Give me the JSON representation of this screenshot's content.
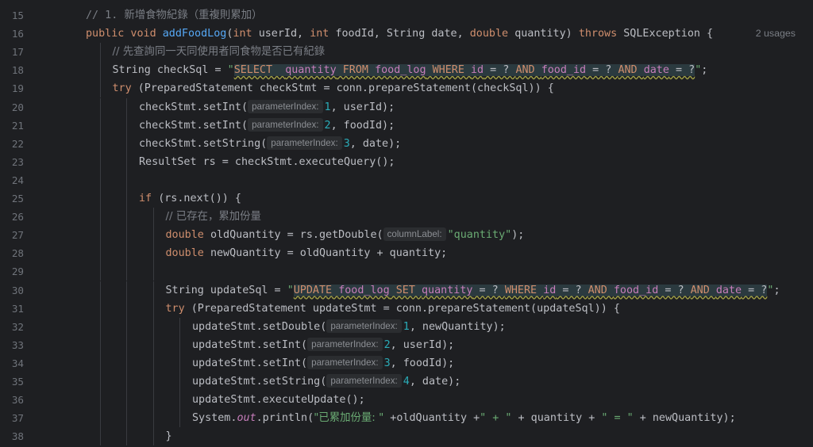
{
  "editor": {
    "usages": "2 usages",
    "lines": [
      {
        "n": "15",
        "indent": 1,
        "tokens": [
          [
            "cmt",
            "// 1. "
          ],
          [
            "cmt",
            "新增食物紀錄（重複則累加）"
          ]
        ]
      },
      {
        "n": "16",
        "indent": 1,
        "tokens": [
          [
            "kw",
            "public void "
          ],
          [
            "fn",
            "addFoodLog"
          ],
          [
            "plain",
            "("
          ],
          [
            "kw",
            "int "
          ],
          [
            "plain",
            "userId, "
          ],
          [
            "kw",
            "int "
          ],
          [
            "plain",
            "foodId, String date, "
          ],
          [
            "kw",
            "double "
          ],
          [
            "plain",
            "quantity) "
          ],
          [
            "kw",
            "throws "
          ],
          [
            "plain",
            "SQLException {"
          ]
        ]
      },
      {
        "n": "17",
        "indent": 2,
        "tokens": [
          [
            "cmt",
            "// 先查詢同一天同使用者同食物是否已有紀錄"
          ]
        ]
      },
      {
        "n": "18",
        "indent": 2,
        "tokens": [
          [
            "plain",
            "String checkSql = "
          ],
          [
            "str",
            "\""
          ],
          [
            "sql-kw",
            "SELECT  "
          ],
          [
            "sql-id",
            "quantity"
          ],
          [
            "sql-kw",
            " FROM "
          ],
          [
            "sql-id",
            "food_log"
          ],
          [
            "sql-kw",
            " WHERE "
          ],
          [
            "sql-id",
            "id"
          ],
          [
            "sql-ph",
            " = ? "
          ],
          [
            "sql-kw",
            "AND "
          ],
          [
            "sql-id",
            "food_id"
          ],
          [
            "sql-ph",
            " = ? "
          ],
          [
            "sql-kw",
            "AND "
          ],
          [
            "sql-id",
            "date"
          ],
          [
            "sql-ph",
            " = ?"
          ],
          [
            "str",
            "\""
          ],
          [
            "plain",
            ";"
          ]
        ]
      },
      {
        "n": "19",
        "indent": 2,
        "tokens": [
          [
            "kw",
            "try "
          ],
          [
            "plain",
            "(PreparedStatement checkStmt = "
          ],
          [
            "plain",
            "conn"
          ],
          [
            "plain",
            ".prepareStatement(checkSql)) {"
          ]
        ]
      },
      {
        "n": "20",
        "indent": 3,
        "tokens": [
          [
            "plain",
            "checkStmt.setInt("
          ],
          [
            "hint",
            "parameterIndex:"
          ],
          [
            "num",
            "1"
          ],
          [
            "plain",
            ", userId);"
          ]
        ]
      },
      {
        "n": "21",
        "indent": 3,
        "tokens": [
          [
            "plain",
            "checkStmt.setInt("
          ],
          [
            "hint",
            "parameterIndex:"
          ],
          [
            "num",
            "2"
          ],
          [
            "plain",
            ", foodId);"
          ]
        ]
      },
      {
        "n": "22",
        "indent": 3,
        "tokens": [
          [
            "plain",
            "checkStmt.setString("
          ],
          [
            "hint",
            "parameterIndex:"
          ],
          [
            "num",
            "3"
          ],
          [
            "plain",
            ", date);"
          ]
        ]
      },
      {
        "n": "23",
        "indent": 3,
        "tokens": [
          [
            "plain",
            "ResultSet rs = checkStmt.executeQuery();"
          ]
        ]
      },
      {
        "n": "24",
        "indent": 3,
        "tokens": []
      },
      {
        "n": "25",
        "indent": 3,
        "tokens": [
          [
            "kw",
            "if "
          ],
          [
            "plain",
            "(rs.next()) {"
          ]
        ]
      },
      {
        "n": "26",
        "indent": 4,
        "tokens": [
          [
            "cmt",
            "// 已存在，累加份量"
          ]
        ]
      },
      {
        "n": "27",
        "indent": 4,
        "tokens": [
          [
            "kw",
            "double "
          ],
          [
            "plain",
            "oldQuantity = rs.getDouble("
          ],
          [
            "hint",
            "columnLabel:"
          ],
          [
            "str",
            "\"quantity\""
          ],
          [
            "plain",
            ");"
          ]
        ]
      },
      {
        "n": "28",
        "indent": 4,
        "tokens": [
          [
            "kw",
            "double "
          ],
          [
            "plain",
            "newQuantity = oldQuantity + quantity;"
          ]
        ]
      },
      {
        "n": "29",
        "indent": 4,
        "tokens": []
      },
      {
        "n": "30",
        "indent": 4,
        "tokens": [
          [
            "plain",
            "String updateSql = "
          ],
          [
            "str",
            "\""
          ],
          [
            "sql-kw",
            "UPDATE "
          ],
          [
            "sql-id",
            "food_log"
          ],
          [
            "sql-kw",
            " SET "
          ],
          [
            "sql-id",
            "quantity"
          ],
          [
            "sql-ph",
            " = ? "
          ],
          [
            "sql-kw",
            "WHERE "
          ],
          [
            "sql-id",
            "id"
          ],
          [
            "sql-ph",
            " = ? "
          ],
          [
            "sql-kw",
            "AND "
          ],
          [
            "sql-id",
            "food_id"
          ],
          [
            "sql-ph",
            " = ? "
          ],
          [
            "sql-kw",
            "AND "
          ],
          [
            "sql-id",
            "date"
          ],
          [
            "sql-ph",
            " = ?"
          ],
          [
            "str",
            "\""
          ],
          [
            "plain",
            ";"
          ]
        ]
      },
      {
        "n": "31",
        "indent": 4,
        "tokens": [
          [
            "kw",
            "try "
          ],
          [
            "plain",
            "(PreparedStatement updateStmt = "
          ],
          [
            "plain",
            "conn"
          ],
          [
            "plain",
            ".prepareStatement(updateSql)) {"
          ]
        ]
      },
      {
        "n": "32",
        "indent": 5,
        "tokens": [
          [
            "plain",
            "updateStmt.setDouble("
          ],
          [
            "hint",
            "parameterIndex:"
          ],
          [
            "num",
            "1"
          ],
          [
            "plain",
            ", newQuantity);"
          ]
        ]
      },
      {
        "n": "33",
        "indent": 5,
        "tokens": [
          [
            "plain",
            "updateStmt.setInt("
          ],
          [
            "hint",
            "parameterIndex:"
          ],
          [
            "num",
            "2"
          ],
          [
            "plain",
            ", userId);"
          ]
        ]
      },
      {
        "n": "34",
        "indent": 5,
        "tokens": [
          [
            "plain",
            "updateStmt.setInt("
          ],
          [
            "hint",
            "parameterIndex:"
          ],
          [
            "num",
            "3"
          ],
          [
            "plain",
            ", foodId);"
          ]
        ]
      },
      {
        "n": "35",
        "indent": 5,
        "tokens": [
          [
            "plain",
            "updateStmt.setString("
          ],
          [
            "hint",
            "parameterIndex:"
          ],
          [
            "num",
            "4"
          ],
          [
            "plain",
            ", date);"
          ]
        ]
      },
      {
        "n": "36",
        "indent": 5,
        "tokens": [
          [
            "plain",
            "updateStmt.executeUpdate();"
          ]
        ]
      },
      {
        "n": "37",
        "indent": 5,
        "tokens": [
          [
            "plain",
            "System."
          ],
          [
            "field",
            "out"
          ],
          [
            "plain",
            ".println("
          ],
          [
            "str",
            "\"已累加份量: \""
          ],
          [
            "plain",
            " +oldQuantity +"
          ],
          [
            "str",
            "\" + \""
          ],
          [
            "plain",
            " + quantity + "
          ],
          [
            "str",
            "\" = \""
          ],
          [
            "plain",
            " + newQuantity);"
          ]
        ]
      },
      {
        "n": "38",
        "indent": 4,
        "tokens": [
          [
            "plain",
            "}"
          ]
        ]
      }
    ]
  }
}
